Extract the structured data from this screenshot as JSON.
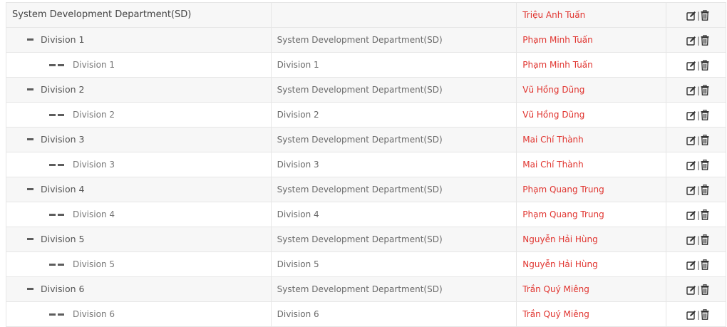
{
  "rows": [
    {
      "level": 0,
      "name": "System Development Department(SD)",
      "parent": "",
      "manager": "Triệu Anh Tuấn"
    },
    {
      "level": 1,
      "name": "Division 1",
      "parent": "System Development Department(SD)",
      "manager": "Phạm Minh Tuấn"
    },
    {
      "level": 2,
      "name": "Division 1",
      "parent": "Division 1",
      "manager": "Phạm Minh Tuấn"
    },
    {
      "level": 1,
      "name": "Division 2",
      "parent": "System Development Department(SD)",
      "manager": "Vũ Hồng Dũng"
    },
    {
      "level": 2,
      "name": "Division 2",
      "parent": "Division 2",
      "manager": "Vũ Hồng Dũng"
    },
    {
      "level": 1,
      "name": "Division 3",
      "parent": "System Development Department(SD)",
      "manager": "Mai Chí Thành"
    },
    {
      "level": 2,
      "name": "Division 3",
      "parent": "Division 3",
      "manager": "Mai Chí Thành"
    },
    {
      "level": 1,
      "name": "Division 4",
      "parent": "System Development Department(SD)",
      "manager": "Phạm Quang Trung"
    },
    {
      "level": 2,
      "name": "Division 4",
      "parent": "Division 4",
      "manager": "Phạm Quang Trung"
    },
    {
      "level": 1,
      "name": "Division 5",
      "parent": "System Development Department(SD)",
      "manager": "Nguyễn Hải Hùng"
    },
    {
      "level": 2,
      "name": "Division 5",
      "parent": "Division 5",
      "manager": "Nguyễn Hải Hùng"
    },
    {
      "level": 1,
      "name": "Division 6",
      "parent": "System Development Department(SD)",
      "manager": "Trần Quý Miêng"
    },
    {
      "level": 2,
      "name": "Division 6",
      "parent": "Division 6",
      "manager": "Trần Quý Miêng"
    }
  ],
  "actions": {
    "separator": "|",
    "edit_icon": "edit-icon",
    "delete_icon": "trash-icon"
  },
  "colors": {
    "manager_text": "#e0332e",
    "border": "#e6e6e6",
    "row_alt": "#f7f7f7"
  }
}
